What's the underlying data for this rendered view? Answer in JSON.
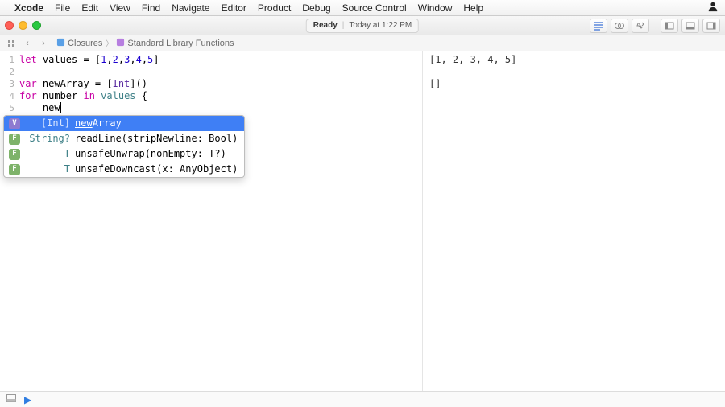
{
  "menubar": {
    "app": "Xcode",
    "items": [
      "File",
      "Edit",
      "View",
      "Find",
      "Navigate",
      "Editor",
      "Product",
      "Debug",
      "Source Control",
      "Window",
      "Help"
    ]
  },
  "toolbar": {
    "status_ready": "Ready",
    "status_time": "Today at 1:22 PM"
  },
  "jumpbar": {
    "crumb1": "Closures",
    "crumb2": "Standard Library Functions"
  },
  "code": {
    "lines": [
      {
        "n": "1",
        "html": "<span class='kw'>let</span> values = [<span class='num'>1</span>,<span class='num'>2</span>,<span class='num'>3</span>,<span class='num'>4</span>,<span class='num'>5</span>]"
      },
      {
        "n": "2",
        "html": ""
      },
      {
        "n": "3",
        "html": "<span class='kw'>var</span> newArray = [<span class='typ'>Int</span>]()"
      },
      {
        "n": "4",
        "html": "<span class='kw'>for</span> number <span class='kw'>in</span> <span class='ident'>values</span> {"
      },
      {
        "n": "5",
        "html": "    new<span class='caret'></span>"
      }
    ]
  },
  "results": {
    "line1": "[1, 2, 3, 4, 5]",
    "line3": "[]"
  },
  "autocomplete": {
    "items": [
      {
        "badge": "V",
        "type": "[Int]",
        "sig": "newArray",
        "highlight": "new",
        "selected": true
      },
      {
        "badge": "F",
        "type": "String?",
        "sig": "readLine(stripNewline: Bool)",
        "selected": false
      },
      {
        "badge": "F",
        "type": "T",
        "sig": "unsafeUnwrap(nonEmpty: T?)",
        "selected": false
      },
      {
        "badge": "F",
        "type": "T",
        "sig": "unsafeDowncast(x: AnyObject)",
        "selected": false
      }
    ]
  }
}
